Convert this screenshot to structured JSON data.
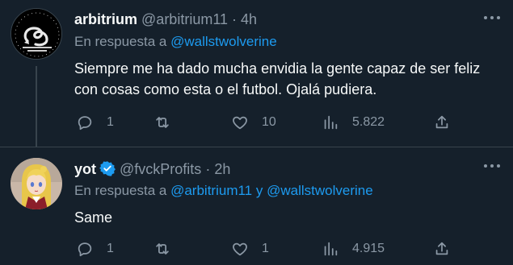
{
  "tweets": [
    {
      "display_name": "arbitrium",
      "handle": "@arbitrium11",
      "separator": "·",
      "time": "4h",
      "reply_prefix": "En respuesta a",
      "reply_mention_1": "@wallstwolverine",
      "reply_join": "",
      "reply_mention_2": "",
      "text": "Siempre me ha dado mucha envidia la gente capaz de ser feliz con cosas como esta o el futbol. Ojalá pudiera.",
      "replies": "1",
      "retweets": "",
      "likes": "10",
      "views": "5.822",
      "avatar_icon": "gadsden-flag-avatar"
    },
    {
      "display_name": "yot",
      "handle": "@fvckProfits",
      "separator": "·",
      "time": "2h",
      "reply_prefix": "En respuesta a",
      "reply_mention_1": "@arbitrium11",
      "reply_join": "y",
      "reply_mention_2": "@wallstwolverine",
      "text": "Same",
      "replies": "1",
      "retweets": "",
      "likes": "1",
      "views": "4.915",
      "avatar_icon": "anime-girl-avatar",
      "verified": true
    }
  ],
  "colors": {
    "background": "#15202b",
    "text": "#f7f9f9",
    "secondary": "#8b98a5",
    "accent": "#1d9bf0",
    "divider": "#38444d"
  }
}
